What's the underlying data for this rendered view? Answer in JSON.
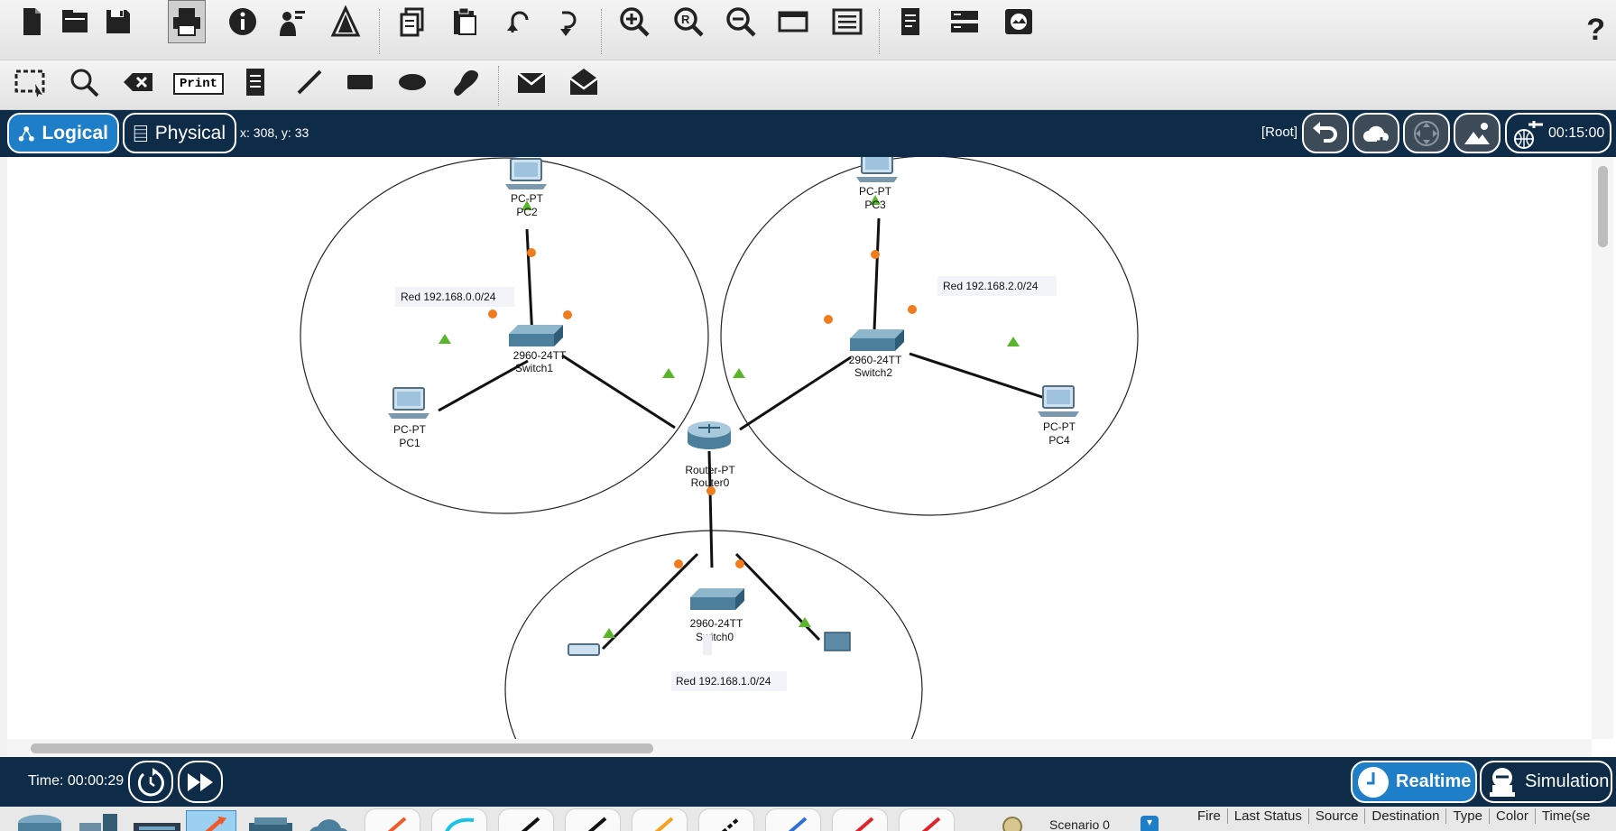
{
  "toolbar1": {
    "icons": [
      "new-icon",
      "open-icon",
      "save-icon",
      "print-icon",
      "info-icon",
      "activity-wizard-icon",
      "custom-device-icon",
      "copy-icon",
      "paste-icon",
      "undo-icon",
      "redo-icon",
      "zoom-in-icon",
      "zoom-reset-icon",
      "zoom-out-icon",
      "drawing-palette-icon",
      "custom-devices-dialog-icon",
      "file-icon",
      "device-icon",
      "image-icon"
    ],
    "help": "?"
  },
  "toolbar2": {
    "print_label": "Print"
  },
  "nav": {
    "logical": "Logical",
    "physical": "Physical",
    "coords": "x: 308, y: 33",
    "root": "[Root]",
    "clock": "00:15:00"
  },
  "network": {
    "devices": [
      {
        "id": "pc2",
        "type": "PC-PT",
        "name": "PC2"
      },
      {
        "id": "pc3",
        "type": "PC-PT",
        "name": "PC3"
      },
      {
        "id": "pc1",
        "type": "PC-PT",
        "name": "PC1"
      },
      {
        "id": "pc4",
        "type": "PC-PT",
        "name": "PC4"
      },
      {
        "id": "switch1",
        "type": "2960-24TT",
        "name": "Switch1"
      },
      {
        "id": "switch2",
        "type": "2960-24TT",
        "name": "Switch2"
      },
      {
        "id": "switch0",
        "type": "2960-24TT",
        "name": "Switch0"
      },
      {
        "id": "router0",
        "type": "Router-PT",
        "name": "Router0"
      }
    ],
    "notes": [
      "Red 192.168.0.0/24",
      "Red 192.168.2.0/24",
      "Red 192.168.1.0/24"
    ]
  },
  "bottom": {
    "time": "Time: 00:00:29",
    "realtime": "Realtime",
    "simulation": "Simulation",
    "scenario": "Scenario 0",
    "scenario_arrow": "▾",
    "pdu_columns": [
      "Fire",
      "Last Status",
      "Source",
      "Destination",
      "Type",
      "Color",
      "Time(se"
    ]
  },
  "colors": {
    "navbar": "#0e2c48",
    "accent": "#1e7fc8",
    "link_up": "#5bb52a",
    "link_port": "#f07c1e"
  }
}
